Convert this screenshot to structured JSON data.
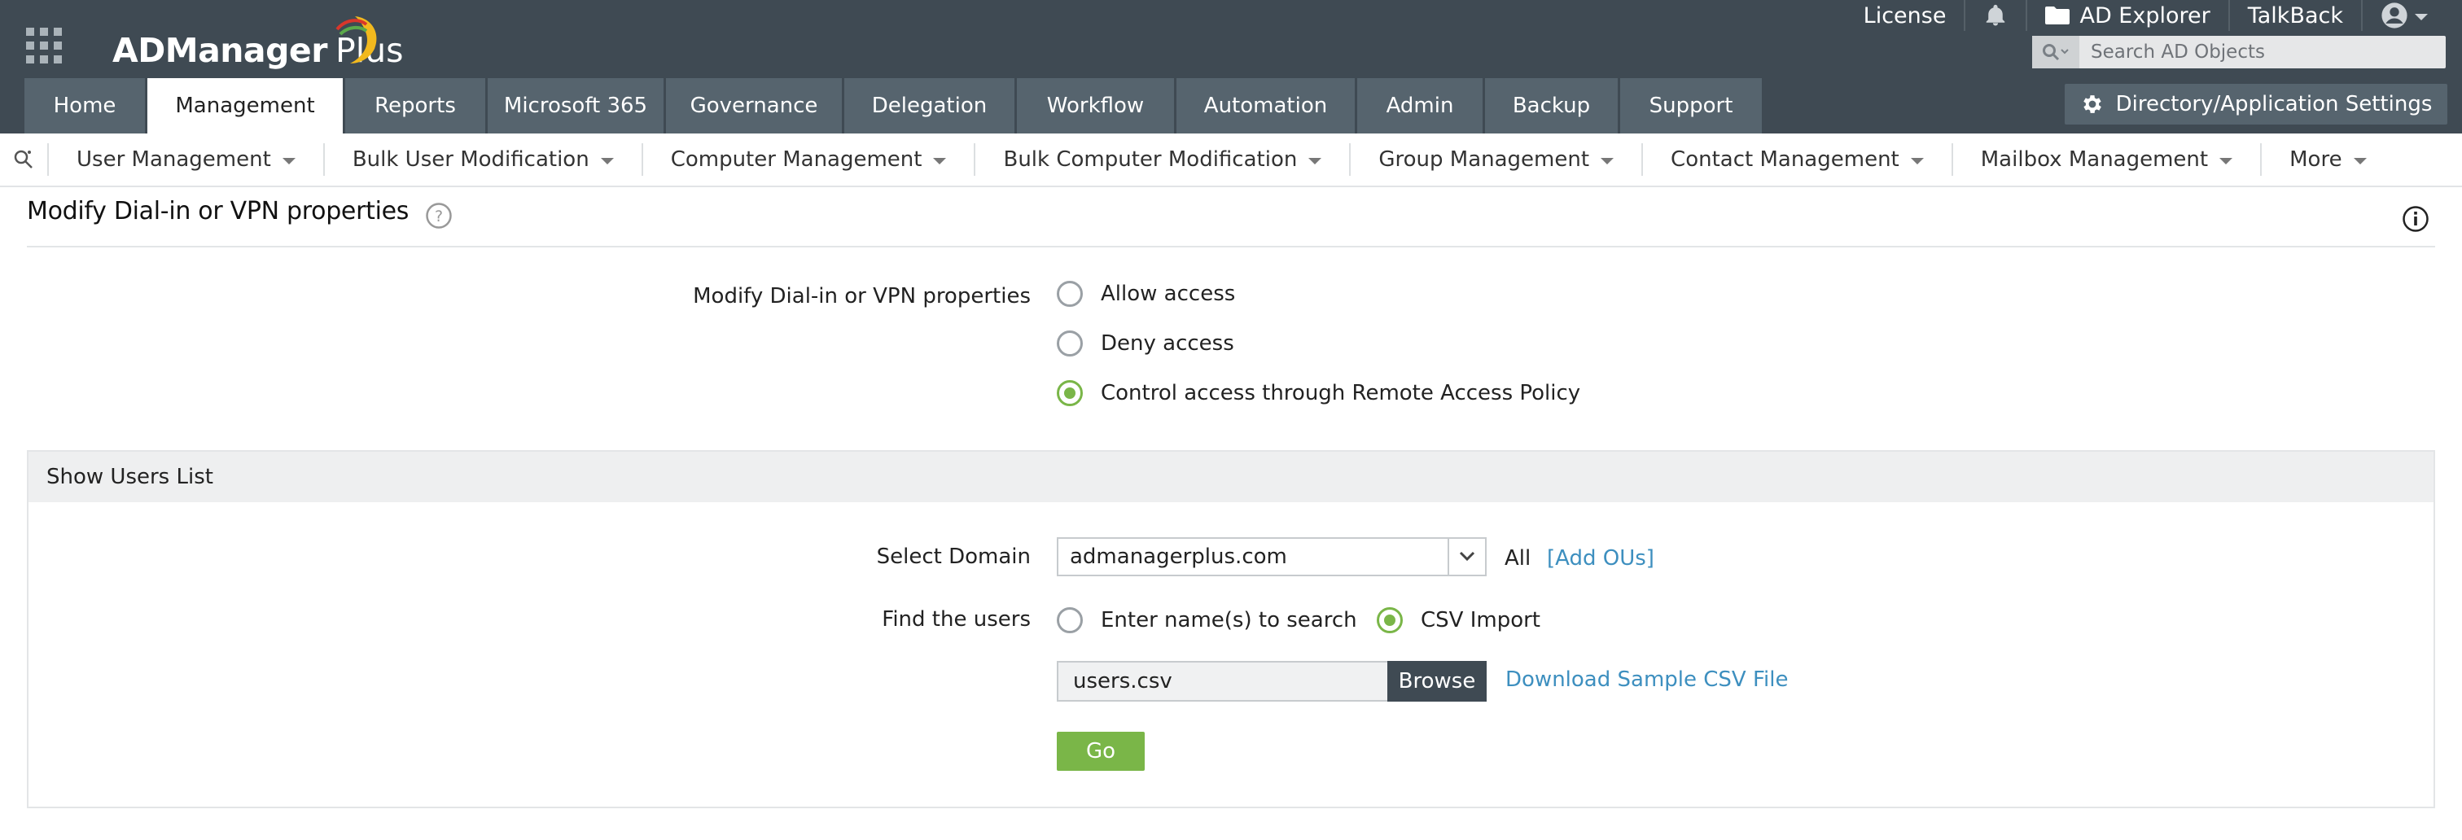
{
  "header": {
    "logo_text": "ADManager",
    "logo_plus": "Plus",
    "links": [
      {
        "label": "License",
        "icon": "none"
      },
      {
        "label": "",
        "icon": "bell-icon"
      },
      {
        "label": "AD Explorer",
        "icon": "folder-icon"
      },
      {
        "label": "TalkBack",
        "icon": "none"
      },
      {
        "label": "",
        "icon": "user-avatar-icon"
      }
    ],
    "search_placeholder": "Search AD Objects",
    "settings_label": "Directory/Application Settings",
    "brand_color": "#3f4a53",
    "tab_color": "#56646e"
  },
  "tabs": [
    {
      "label": "Home",
      "active": false
    },
    {
      "label": "Management",
      "active": true
    },
    {
      "label": "Reports",
      "active": false
    },
    {
      "label": "Microsoft 365",
      "active": false
    },
    {
      "label": "Governance",
      "active": false
    },
    {
      "label": "Delegation",
      "active": false
    },
    {
      "label": "Workflow",
      "active": false
    },
    {
      "label": "Automation",
      "active": false
    },
    {
      "label": "Admin",
      "active": false
    },
    {
      "label": "Backup",
      "active": false
    },
    {
      "label": "Support",
      "active": false
    }
  ],
  "subnav": [
    "User Management",
    "Bulk User Modification",
    "Computer Management",
    "Bulk Computer Modification",
    "Group Management",
    "Contact Management",
    "Mailbox Management",
    "More"
  ],
  "page": {
    "title": "Modify Dial-in or VPN properties",
    "option_label": "Modify Dial-in or VPN properties",
    "options": [
      {
        "label": "Allow access",
        "checked": false
      },
      {
        "label": "Deny access",
        "checked": false
      },
      {
        "label": "Control access through Remote Access Policy",
        "checked": true
      }
    ]
  },
  "users_panel": {
    "header": "Show Users List",
    "domain_label": "Select Domain",
    "domain_value": "admanagerplus.com",
    "all_label": "All",
    "add_ous": "[Add OUs]",
    "find_label": "Find the users",
    "find_options": [
      {
        "label": "Enter name(s) to search",
        "checked": false
      },
      {
        "label": "CSV Import",
        "checked": true
      }
    ],
    "file_value": "users.csv",
    "browse_label": "Browse",
    "download_link": "Download Sample CSV File",
    "go_label": "Go",
    "accent_color": "#7ab648",
    "link_color": "#3d8fbf"
  }
}
